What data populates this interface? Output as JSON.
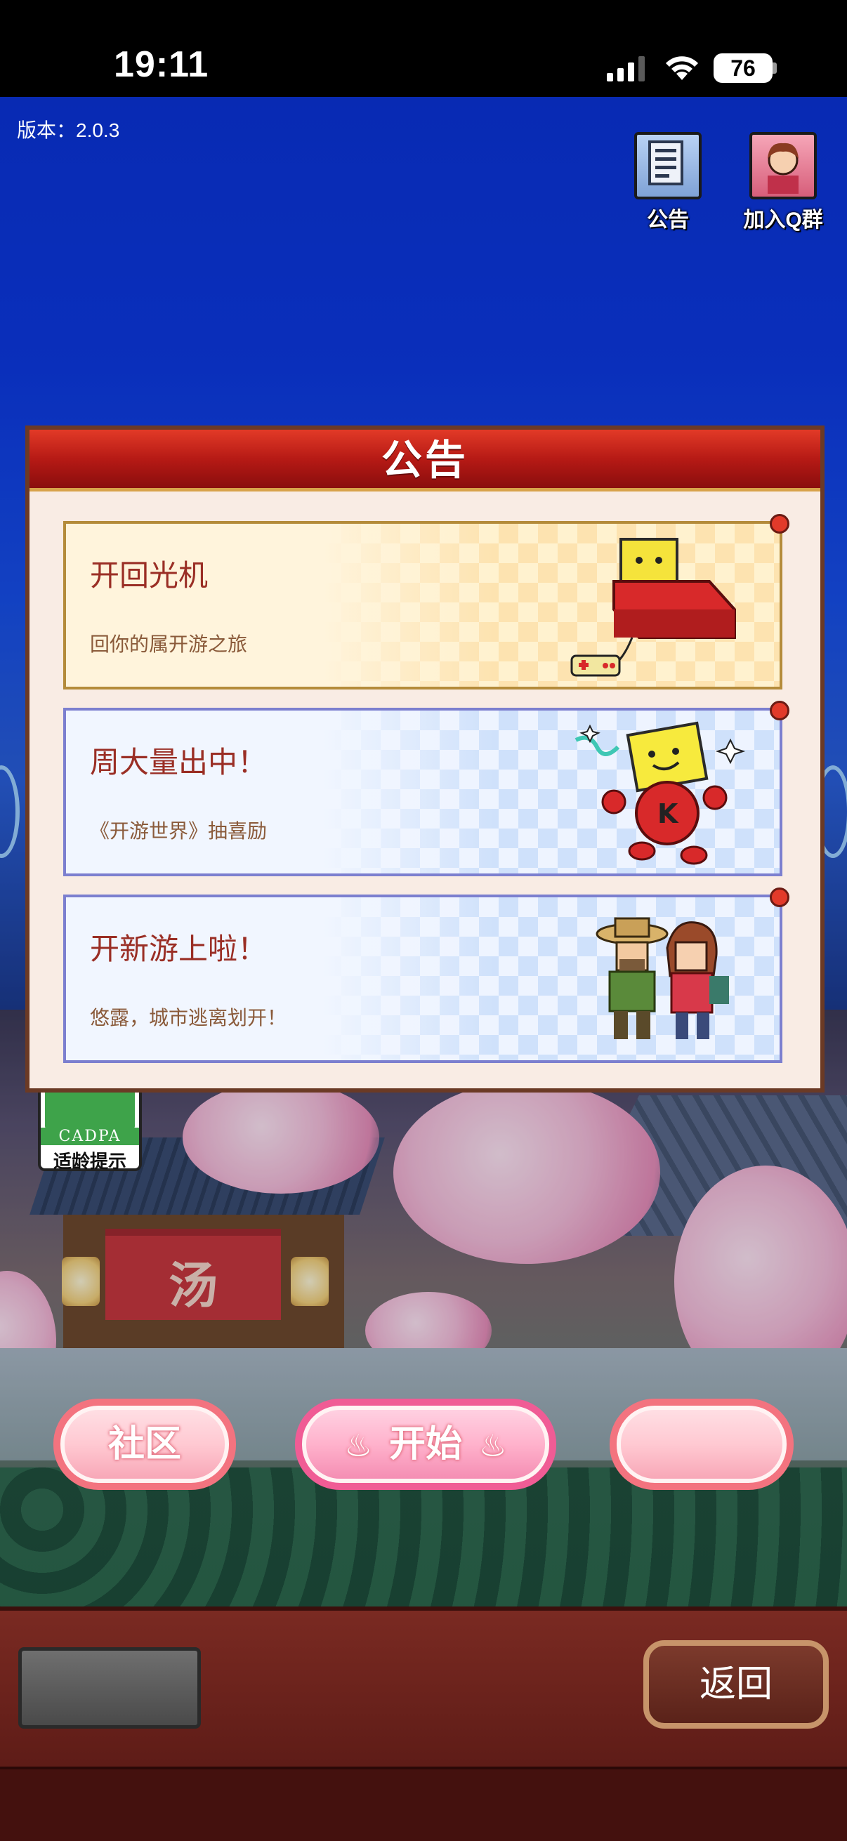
{
  "status_bar": {
    "time": "19:11",
    "battery": "76"
  },
  "version": "版本：2.0.3",
  "top_buttons": {
    "announcement": "公告",
    "join_q_group": "加入Q群"
  },
  "modal": {
    "title": "公告",
    "cards": [
      {
        "title": "开回光机",
        "subtitle": "回你的属开游之旅"
      },
      {
        "title": "周大量出中！",
        "subtitle": "《开游世界》抽喜励"
      },
      {
        "title": "开新游上啦！",
        "subtitle": "悠露，城市逃离划开！"
      }
    ]
  },
  "age_badge": {
    "org": "CADPA",
    "label": "适龄提示"
  },
  "scene": {
    "noren_text": "汤"
  },
  "bottom_buttons": {
    "community": "社区",
    "start": "开始",
    "blank": ""
  },
  "footer": {
    "back": "返回"
  },
  "colors": {
    "modal_header": "#b61a15",
    "accent_pink": "#f3737f",
    "sky": "#0d3ae0"
  }
}
